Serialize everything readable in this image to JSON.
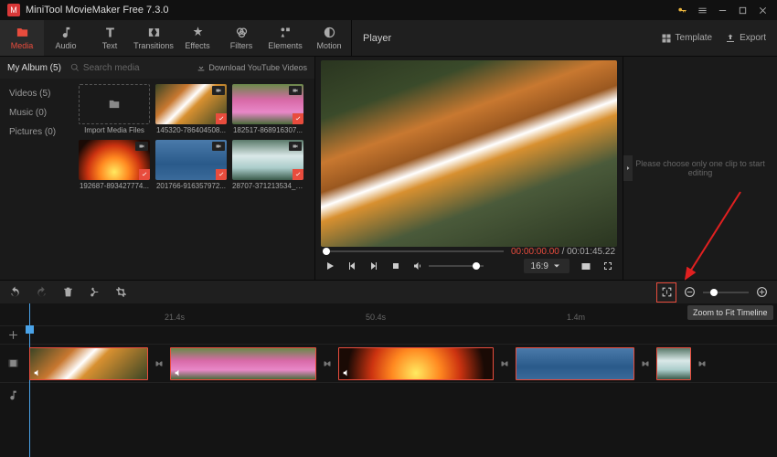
{
  "window": {
    "title": "MiniTool MovieMaker Free 7.3.0"
  },
  "toolbar": {
    "media": "Media",
    "audio": "Audio",
    "text": "Text",
    "transitions": "Transitions",
    "effects": "Effects",
    "filters": "Filters",
    "elements": "Elements",
    "motion": "Motion"
  },
  "player_header": {
    "label": "Player",
    "template": "Template",
    "export": "Export"
  },
  "media": {
    "album": "My Album (5)",
    "search_placeholder": "Search media",
    "youtube": "Download YouTube Videos",
    "cats": {
      "videos": "Videos (5)",
      "music": "Music (0)",
      "pictures": "Pictures (0)"
    },
    "import": "Import Media Files",
    "thumbs": [
      {
        "label": "145320-786404508..."
      },
      {
        "label": "182517-868916307..."
      },
      {
        "label": "192687-893427774..."
      },
      {
        "label": "201766-916357972..."
      },
      {
        "label": "28707-371213534_t..."
      }
    ]
  },
  "preview": {
    "current": "00:00:00.00",
    "total": "00:01:45.22",
    "ratio": "16:9"
  },
  "rightpane": {
    "message": "Please choose only one clip to start editing"
  },
  "ruler": {
    "m1": "21.4s",
    "m2": "50.4s",
    "m3": "1.4m"
  },
  "tooltip": {
    "zoomfit": "Zoom to Fit Timeline"
  }
}
